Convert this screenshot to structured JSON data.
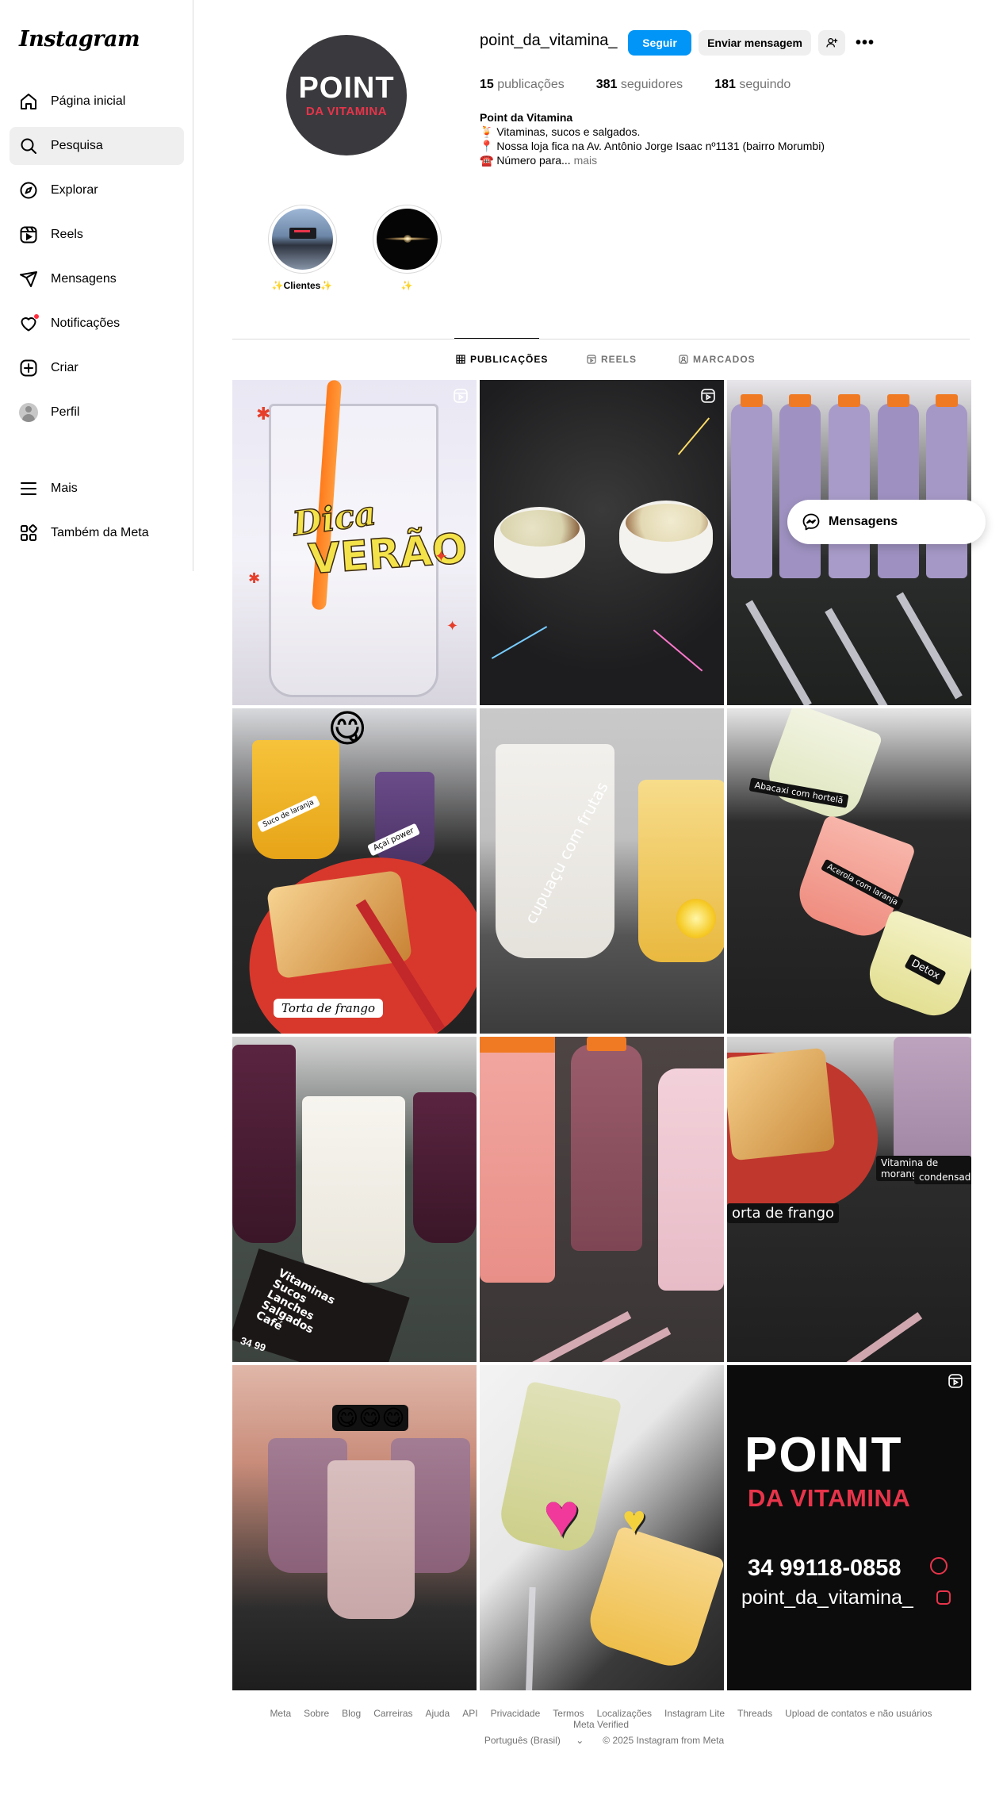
{
  "sidebar": {
    "logo": "Instagram",
    "items": [
      {
        "label": "Página inicial",
        "icon": "home-icon"
      },
      {
        "label": "Pesquisa",
        "icon": "search-icon"
      },
      {
        "label": "Explorar",
        "icon": "compass-icon"
      },
      {
        "label": "Reels",
        "icon": "reels-icon"
      },
      {
        "label": "Mensagens",
        "icon": "paper-plane-icon"
      },
      {
        "label": "Notificações",
        "icon": "heart-icon"
      },
      {
        "label": "Criar",
        "icon": "plus-square-icon"
      },
      {
        "label": "Perfil",
        "icon": "avatar"
      }
    ],
    "more_label": "Mais",
    "meta_label": "Também da Meta"
  },
  "profile": {
    "pic_word": "POINT",
    "pic_sub": "DA VITAMINA",
    "username": "point_da_vitamina_",
    "follow_label": "Seguir",
    "message_label": "Enviar mensagem",
    "more_glyph": "•••",
    "stats": {
      "posts_count": "15",
      "posts_label": "publicações",
      "followers_count": "381",
      "followers_label": "seguidores",
      "following_count": "181",
      "following_label": "seguindo"
    },
    "bio": {
      "name": "Point da Vitamina",
      "line1": "🍹 Vitaminas, sucos e salgados.",
      "line2": "📍 Nossa loja fica na Av. Antônio Jorge Isaac nº1131 (bairro Morumbi)",
      "line3": "☎️ Número para...",
      "more": "mais"
    }
  },
  "highlights": [
    {
      "label": "✨Clientes✨"
    },
    {
      "label": "✨"
    }
  ],
  "tabs": [
    {
      "label": "PUBLICAÇÕES"
    },
    {
      "label": "REELS"
    },
    {
      "label": "MARCADOS"
    }
  ],
  "posts": {
    "p1_text1": "Dica",
    "p1_text2": "VERÃO",
    "p4_emoji": "😋",
    "p4_cap1": "Suco de laranja",
    "p4_cap2": "Açaí power",
    "p4_cap3": "Torta de frango",
    "p5_cap": "cupuaçu com frutas",
    "p6_cap1": "Abacaxi com hortelã",
    "p6_cap2": "Acerola com laranja",
    "p6_cap3": "Detox",
    "p7_flyer": "Vitaminas\nSucos\nLanches\nSalgados\nCafé",
    "p7_phone": "34 99",
    "p9_cap1": "Vitamina de morango",
    "p9_cap2": "condensado",
    "p9_cap3": "orta de frango",
    "p10_emoji": "😋😋😋",
    "p12_word1": "POINT",
    "p12_word2": "DA VITAMINA",
    "p12_phone": "34 99118-0858",
    "p12_handle": "point_da_vitamina_"
  },
  "floating_messages": "Mensagens",
  "footer": {
    "links": [
      "Meta",
      "Sobre",
      "Blog",
      "Carreiras",
      "Ajuda",
      "API",
      "Privacidade",
      "Termos",
      "Localizações",
      "Instagram Lite",
      "Threads",
      "Upload de contatos e não usuários",
      "Meta Verified"
    ],
    "language": "Português (Brasil)",
    "copyright": "© 2025 Instagram from Meta"
  },
  "colors": {
    "accent": "#0095f6",
    "brand_red": "#e8344a",
    "notif": "#ff3040"
  }
}
